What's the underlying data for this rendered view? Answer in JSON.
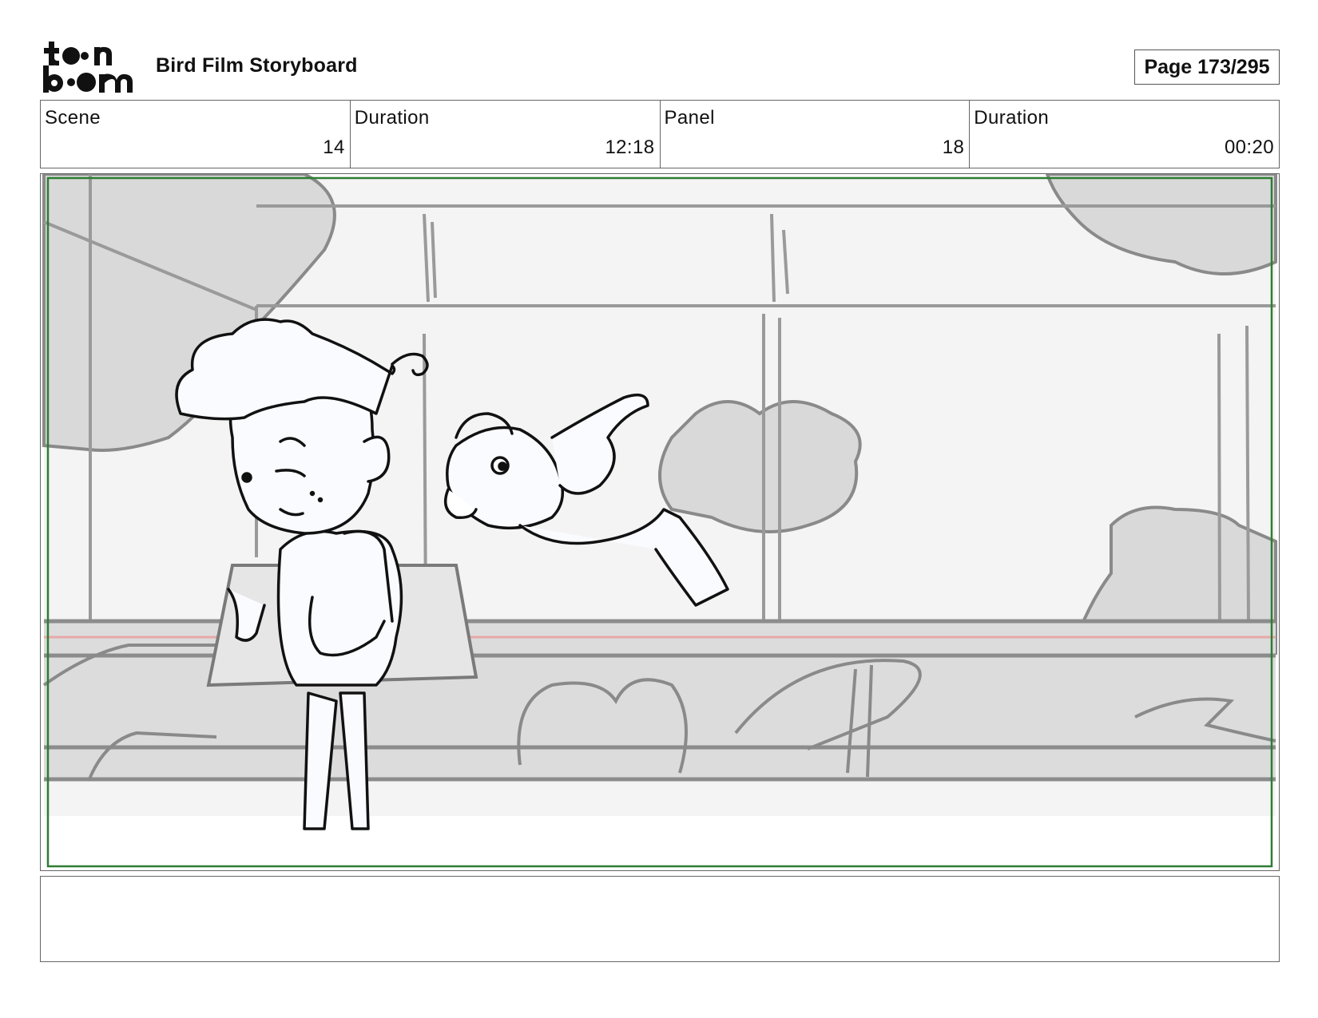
{
  "header": {
    "logo_name": "toon-boom-logo",
    "title": "Bird Film Storyboard",
    "page_indicator": "Page 173/295"
  },
  "info_fields": [
    {
      "label": "Scene",
      "value": "14"
    },
    {
      "label": "Duration",
      "value": "12:18"
    },
    {
      "label": "Panel",
      "value": "18"
    },
    {
      "label": "Duration",
      "value": "00:20"
    }
  ],
  "panel": {
    "image_name": "storyboard-sketch-boy-and-bird",
    "safe_frame_color": "#2e7d32"
  },
  "caption": {
    "text": ""
  }
}
